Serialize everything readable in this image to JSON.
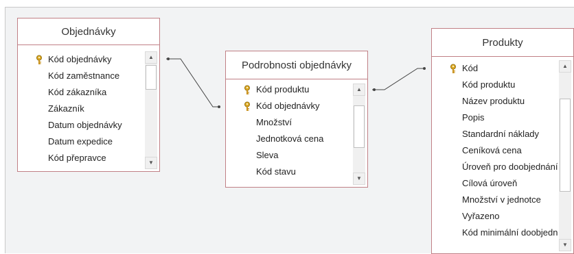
{
  "tables": [
    {
      "id": "objednavky",
      "title": "Objednávky",
      "fields": [
        {
          "label": "Kód objednávky",
          "key": true
        },
        {
          "label": "Kód zaměstnance",
          "key": false
        },
        {
          "label": "Kód zákazníka",
          "key": false
        },
        {
          "label": "Zákazník",
          "key": false
        },
        {
          "label": "Datum objednávky",
          "key": false
        },
        {
          "label": "Datum expedice",
          "key": false
        },
        {
          "label": "Kód přepravce",
          "key": false
        }
      ]
    },
    {
      "id": "podrobnosti",
      "title": "Podrobnosti objednávky",
      "fields": [
        {
          "label": "Kód produktu",
          "key": true
        },
        {
          "label": "Kód objednávky",
          "key": true
        },
        {
          "label": "Množství",
          "key": false
        },
        {
          "label": "Jednotková cena",
          "key": false
        },
        {
          "label": "Sleva",
          "key": false
        },
        {
          "label": "Kód stavu",
          "key": false
        }
      ]
    },
    {
      "id": "produkty",
      "title": "Produkty",
      "fields": [
        {
          "label": "Kód",
          "key": true
        },
        {
          "label": "Kód produktu",
          "key": false
        },
        {
          "label": "Název produktu",
          "key": false
        },
        {
          "label": "Popis",
          "key": false
        },
        {
          "label": "Standardní náklady",
          "key": false
        },
        {
          "label": "Ceníková cena",
          "key": false
        },
        {
          "label": "Úroveň pro doobjednání",
          "key": false
        },
        {
          "label": "Cílová úroveň",
          "key": false
        },
        {
          "label": "Množství v jednotce",
          "key": false
        },
        {
          "label": "Vyřazeno",
          "key": false
        },
        {
          "label": "Kód minimální doobjednávky",
          "key": false
        }
      ]
    }
  ],
  "icons": {
    "key": "key-icon",
    "scroll_up": "scroll-up-arrow-icon",
    "scroll_down": "scroll-down-arrow-icon"
  },
  "colors": {
    "canvas": "#f2f3f4",
    "table_border": "#c07f85",
    "key_gold": "#d9a520",
    "relationship_line": "#444444"
  }
}
